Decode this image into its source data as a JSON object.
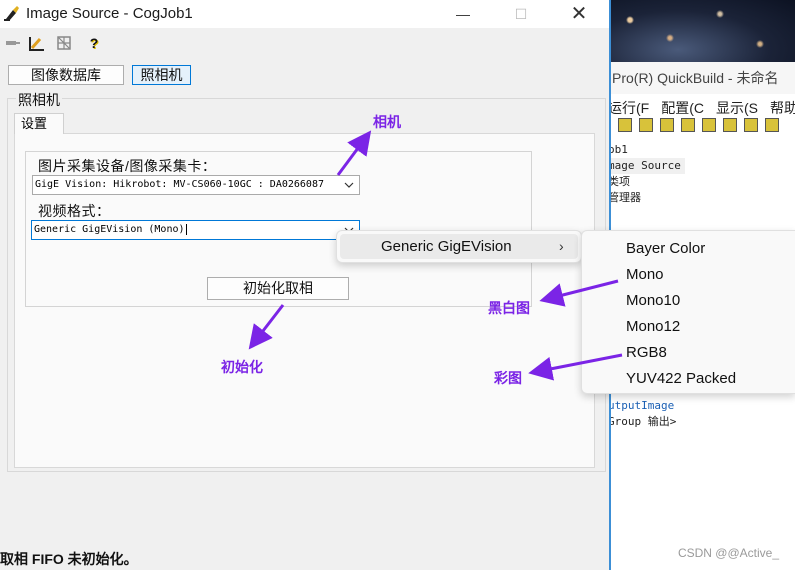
{
  "background_app": {
    "title": "Pro(R) QuickBuild - 未命名",
    "menu": [
      "运行(F",
      "配置(C",
      "显示(S",
      "帮助(H"
    ],
    "tree": [
      "ob1",
      "mage Source",
      "类项",
      "管理器"
    ],
    "tree_lower": [
      "utputImage",
      "Group 输出>"
    ],
    "watermark": "CSDN @@Active_"
  },
  "window": {
    "title": "Image Source - CogJob1",
    "minimize": "—",
    "maximize": "☐",
    "close": "✕"
  },
  "toolbar": {
    "icons": [
      "pin-icon",
      "ruler-icon",
      "grid-icon",
      "help-icon"
    ],
    "help_glyph": "?"
  },
  "source_buttons": {
    "database": "图像数据库",
    "camera": "照相机"
  },
  "group": {
    "legend": "照相机",
    "tab": "设置",
    "device_label": "图片采集设备/图像采集卡：",
    "device_value": "GigE Vision: Hikrobot: MV-CS060-10GC : DA0266087",
    "format_label": "视频格式：",
    "format_value": "Generic GigEVision (Mono)",
    "init_button": "初始化取相"
  },
  "status": {
    "text": "取相 FIFO 未初始化。"
  },
  "context_menu": {
    "item": "Generic GigEVision",
    "chevron": "›",
    "submenu": [
      "Bayer Color",
      "Mono",
      "Mono10",
      "Mono12",
      "RGB8",
      "YUV422 Packed"
    ]
  },
  "annotations": {
    "camera": "相机",
    "init": "初始化",
    "mono": "黑白图",
    "color": "彩图",
    "color_hex": "#7b24e6"
  }
}
